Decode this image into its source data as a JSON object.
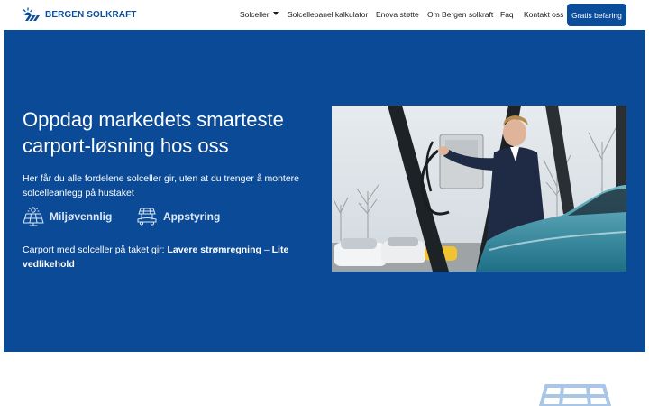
{
  "header": {
    "logo_text": "BERGEN SOLKRAFT",
    "nav": [
      {
        "label": "Solceller",
        "has_dropdown": true
      },
      {
        "label": "Solcellepanel kalkulator"
      },
      {
        "label": "Enova støtte"
      },
      {
        "label": "Om Bergen solkraft"
      },
      {
        "label": "Faq"
      },
      {
        "label": "Kontakt oss"
      }
    ],
    "cta_label": "Gratis befaring"
  },
  "hero": {
    "title": "Oppdag markedets smarteste carport-løsning hos oss",
    "subtitle": "Her får du alle fordelene solceller gir, uten at du trenger å montere solcelleanlegg på hustaket",
    "features": [
      {
        "icon": "solar-panel-icon",
        "label": "Miljøvennlig"
      },
      {
        "icon": "app-control-icon",
        "label": "Appstyring"
      }
    ],
    "bottom_prefix": "Carport med solceller på taket gir: ",
    "bottom_bold_1": "Lavere strømregning",
    "bottom_dash": " – ",
    "bottom_bold_2": "Lite vedlikehold"
  },
  "colors": {
    "brand_blue": "#0a4d9b",
    "hero_background": "#0a4a96",
    "white": "#ffffff"
  }
}
